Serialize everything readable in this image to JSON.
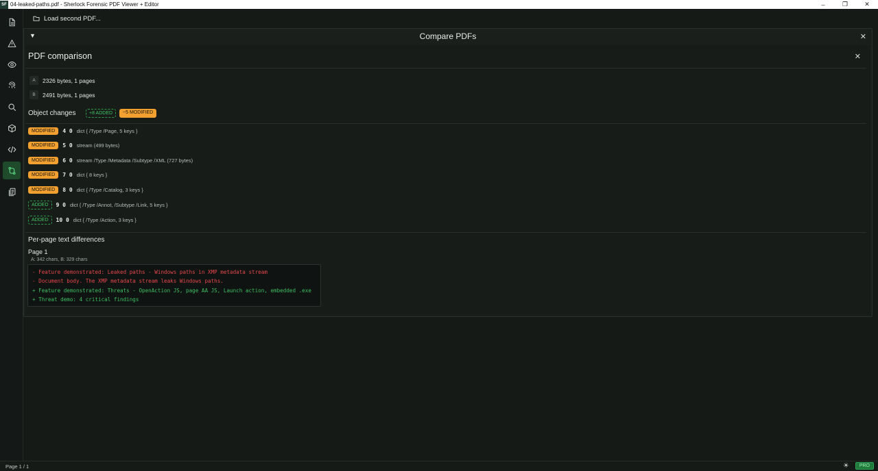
{
  "window": {
    "logo": "SF",
    "title": "04-leaked-paths.pdf - Sherlock Forensic PDF Viewer + Editor",
    "minimize": "–",
    "restore": "❐",
    "close": "✕"
  },
  "sidebar": {
    "items": [
      {
        "icon": "document-icon",
        "active": false
      },
      {
        "icon": "warning-icon",
        "active": false
      },
      {
        "icon": "eye-icon",
        "active": false
      },
      {
        "icon": "fingerprint-icon",
        "active": false
      },
      {
        "icon": "search-icon",
        "active": false
      },
      {
        "icon": "cube-icon",
        "active": false
      },
      {
        "icon": "code-icon",
        "active": false
      },
      {
        "icon": "compare-icon",
        "active": true
      },
      {
        "icon": "pages-icon",
        "active": false
      }
    ],
    "accent_color": "#1f4b2c"
  },
  "toolbar": {
    "load_label": "Load second PDF..."
  },
  "compare": {
    "toggle": "▼",
    "title": "Compare PDFs",
    "close": "✕",
    "section_title": "PDF comparison",
    "section_close": "✕",
    "files": [
      {
        "letter": "A",
        "info": "2326 bytes, 1 pages"
      },
      {
        "letter": "B",
        "info": "2491 bytes, 1 pages"
      }
    ],
    "object_changes_title": "Object changes",
    "added_summary": "+8 ADDED",
    "modified_summary": "~5 MODIFIED",
    "changes": [
      {
        "status": "MODIFIED",
        "ref": "4 0",
        "desc": "dict { /Type /Page, 5 keys }"
      },
      {
        "status": "MODIFIED",
        "ref": "5 0",
        "desc": "stream (499 bytes)"
      },
      {
        "status": "MODIFIED",
        "ref": "6 0",
        "desc": "stream /Type /Metadata /Subtype /XML (727 bytes)"
      },
      {
        "status": "MODIFIED",
        "ref": "7 0",
        "desc": "dict { 8 keys }"
      },
      {
        "status": "MODIFIED",
        "ref": "8 0",
        "desc": "dict { /Type /Catalog, 3 keys }"
      },
      {
        "status": "ADDED",
        "ref": "9 0",
        "desc": "dict { /Type /Annot, /Subtype /Link, 5 keys }"
      },
      {
        "status": "ADDED",
        "ref": "10 0",
        "desc": "dict { /Type /Action, 3 keys }"
      }
    ],
    "text_diff_title": "Per-page text differences",
    "page_label": "Page 1",
    "page_meta": "A: 342 chars, B: 329 chars",
    "diff_lines": [
      {
        "kind": "removed",
        "text": "- Feature demonstrated: Leaked paths - Windows paths in XMP metadata stream"
      },
      {
        "kind": "removed",
        "text": "- Document body. The XMP metadata stream leaks Windows paths."
      },
      {
        "kind": "added",
        "text": "+ Feature demonstrated: Threats - OpenAction JS, page AA JS, Launch action, embedded .exe"
      },
      {
        "kind": "added",
        "text": "+ Threat demo: 4 critical findings"
      }
    ],
    "colors": {
      "modified": "#f2a131",
      "added": "#41c463",
      "removed": "#e5484d"
    }
  },
  "status": {
    "page": "Page 1 / 1",
    "theme_icon": "☀",
    "pro": "PRO"
  }
}
